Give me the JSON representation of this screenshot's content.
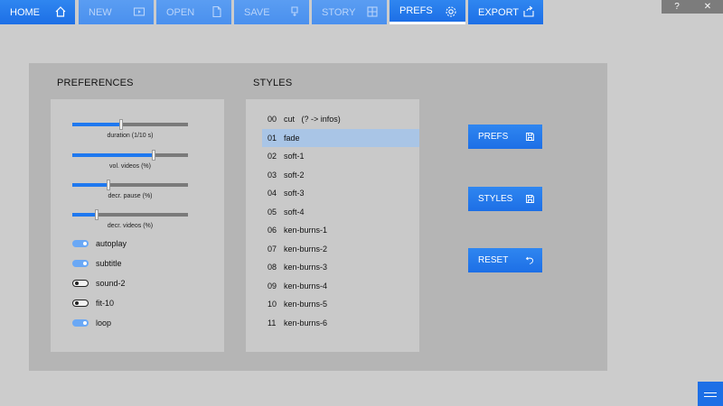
{
  "toolbar": {
    "items": [
      {
        "label": "HOME",
        "icon": "home-icon",
        "state": "normal"
      },
      {
        "label": "NEW",
        "icon": "video-icon",
        "state": "disabled"
      },
      {
        "label": "OPEN",
        "icon": "open-file-icon",
        "state": "disabled"
      },
      {
        "label": "SAVE",
        "icon": "save-icon",
        "state": "disabled"
      },
      {
        "label": "STORY",
        "icon": "grid-icon",
        "state": "disabled"
      },
      {
        "label": "PREFS",
        "icon": "gear-icon",
        "state": "active"
      },
      {
        "label": "EXPORT",
        "icon": "share-icon",
        "state": "normal"
      }
    ]
  },
  "window": {
    "help": "?",
    "close": "✕"
  },
  "preferences": {
    "title": "PREFERENCES",
    "sliders": [
      {
        "label": "duration (1/10 s)",
        "value": 0.42
      },
      {
        "label": "vol. videos (%)",
        "value": 0.7
      },
      {
        "label": "decr. pause (%)",
        "value": 0.31
      },
      {
        "label": "decr. videos (%)",
        "value": 0.21
      }
    ],
    "toggles": [
      {
        "label": "autoplay",
        "on": true
      },
      {
        "label": "subtitle",
        "on": true
      },
      {
        "label": "sound-2",
        "on": false
      },
      {
        "label": "fit-10",
        "on": false
      },
      {
        "label": "loop",
        "on": true
      }
    ]
  },
  "styles": {
    "title": "STYLES",
    "selected_index": 1,
    "items": [
      {
        "index": "00",
        "name": "cut   (? -> infos)"
      },
      {
        "index": "01",
        "name": "fade"
      },
      {
        "index": "02",
        "name": "soft-1"
      },
      {
        "index": "03",
        "name": "soft-2"
      },
      {
        "index": "04",
        "name": "soft-3"
      },
      {
        "index": "05",
        "name": "soft-4"
      },
      {
        "index": "06",
        "name": "ken-burns-1"
      },
      {
        "index": "07",
        "name": "ken-burns-2"
      },
      {
        "index": "08",
        "name": "ken-burns-3"
      },
      {
        "index": "09",
        "name": "ken-burns-4"
      },
      {
        "index": "10",
        "name": "ken-burns-5"
      },
      {
        "index": "11",
        "name": "ken-burns-6"
      }
    ]
  },
  "actions": {
    "prefs": {
      "label": "PREFS",
      "icon": "save-icon"
    },
    "styles": {
      "label": "STYLES",
      "icon": "save-icon"
    },
    "reset": {
      "label": "RESET",
      "icon": "undo-icon"
    }
  },
  "colors": {
    "accent": "#1d6fe6",
    "panel": "#b5b5b5",
    "card": "#c9c9c9",
    "selection": "#a9c5e6"
  }
}
